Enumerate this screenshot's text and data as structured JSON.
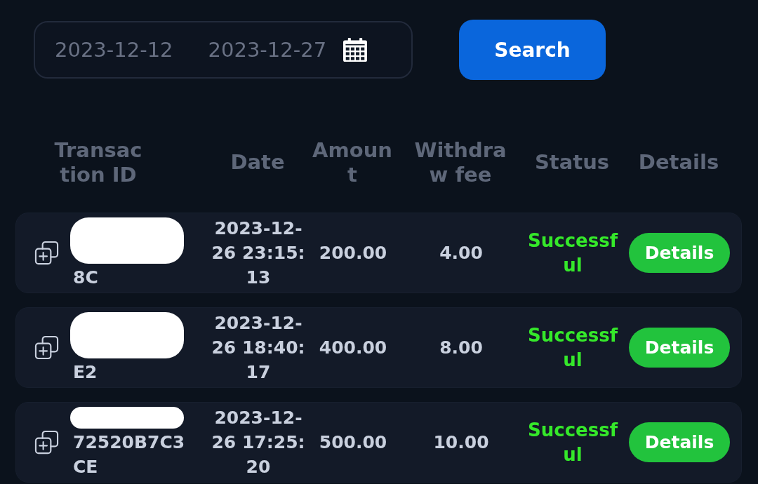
{
  "filter": {
    "start_date": "2023-12-12",
    "end_date": "2023-12-27",
    "search_button": "Search"
  },
  "table": {
    "columns": [
      "Transac\ntion ID",
      "Date",
      "Amoun\nt",
      "Withdra\nw fee",
      "Status",
      "Details"
    ],
    "rows": [
      {
        "transaction_id": [
          {
            "kind": "redacted"
          },
          {
            "kind": "redacted"
          },
          {
            "kind": "text",
            "text": "8C"
          }
        ],
        "date": "2023-12-\n26 23:15:\n13",
        "amount": "200.00",
        "withdraw_fee": "4.00",
        "status": {
          "text": "Successf\nul",
          "kind": "success"
        },
        "details_button": "Details"
      },
      {
        "transaction_id": [
          {
            "kind": "redacted"
          },
          {
            "kind": "redacted"
          },
          {
            "kind": "text",
            "text": "E2"
          }
        ],
        "date": "2023-12-\n26 18:40:\n17",
        "amount": "400.00",
        "withdraw_fee": "8.00",
        "status": {
          "text": "Successf\nul",
          "kind": "success"
        },
        "details_button": "Details"
      },
      {
        "transaction_id": [
          {
            "kind": "redacted"
          },
          {
            "kind": "text",
            "text": "72520B7C3"
          },
          {
            "kind": "text",
            "text": "CE"
          }
        ],
        "date": "2023-12-\n26 17:25:\n20",
        "amount": "500.00",
        "withdraw_fee": "10.00",
        "status": {
          "text": "Successf\nul",
          "kind": "success"
        },
        "details_button": "Details"
      }
    ]
  }
}
